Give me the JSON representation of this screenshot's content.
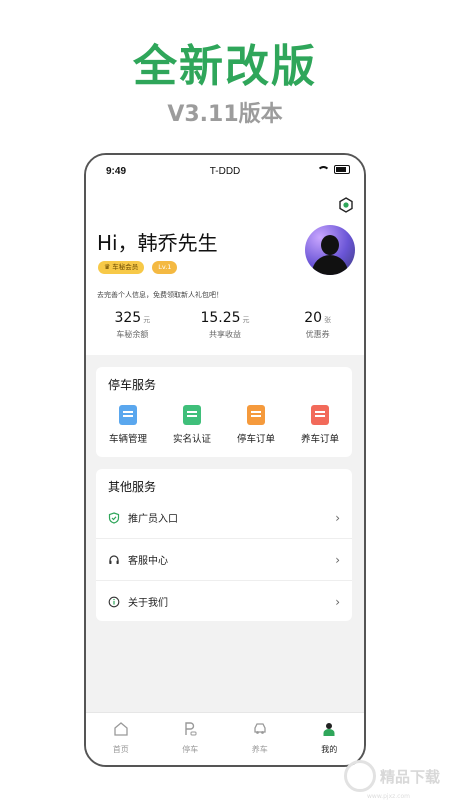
{
  "headline": "全新改版",
  "version": "V3.11版本",
  "status_bar": {
    "time": "9:49",
    "carrier": "T-DDD"
  },
  "profile": {
    "greeting": "Hi，韩乔先生",
    "member_badge": "车秘会员",
    "level_badge": "Lv.1",
    "hint": "去完善个人信息，免费领取新人礼包吧！",
    "stats": [
      {
        "value": "325",
        "unit": "元",
        "label": "车秘余额"
      },
      {
        "value": "15.25",
        "unit": "元",
        "label": "共享收益"
      },
      {
        "value": "20",
        "unit": "张",
        "label": "优惠券"
      }
    ]
  },
  "parking_services": {
    "title": "停车服务",
    "items": [
      {
        "label": "车辆管理",
        "icon": "car-management-icon"
      },
      {
        "label": "实名认证",
        "icon": "verification-icon"
      },
      {
        "label": "停车订单",
        "icon": "parking-order-icon"
      },
      {
        "label": "养车订单",
        "icon": "maintenance-order-icon"
      }
    ]
  },
  "other_services": {
    "title": "其他服务",
    "items": [
      {
        "label": "推广员入口",
        "icon": "shield-check-icon"
      },
      {
        "label": "客服中心",
        "icon": "headset-icon"
      },
      {
        "label": "关于我们",
        "icon": "info-icon"
      }
    ]
  },
  "tabs": [
    {
      "label": "首页",
      "icon": "home-icon"
    },
    {
      "label": "停车",
      "icon": "parking-icon"
    },
    {
      "label": "养车",
      "icon": "car-care-icon"
    },
    {
      "label": "我的",
      "icon": "user-icon",
      "active": true
    }
  ],
  "watermark": {
    "text": "精品下载",
    "sub": "www.pjxz.com"
  },
  "colors": {
    "brand_green": "#2fa65a",
    "badge_yellow": "#f7c948",
    "subtitle_gray": "#9c9c9c"
  }
}
